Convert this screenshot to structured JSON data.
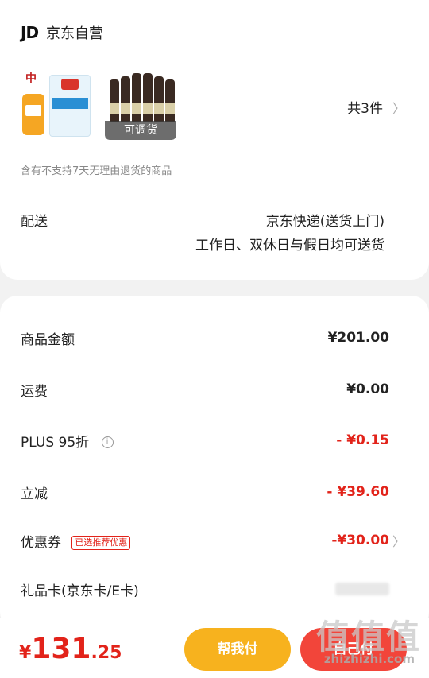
{
  "shop": {
    "logo": "JD",
    "name": "京东自营"
  },
  "products": {
    "beer_overlay": "可调货",
    "count_label": "共3件"
  },
  "notice": "含有不支持7天无理由退货的商品",
  "shipping": {
    "label": "配送",
    "method": "京东快递(送货上门)",
    "days": "工作日、双休日与假日均可送货"
  },
  "summary": {
    "rows": [
      {
        "label": "商品金额",
        "value": "¥201.00"
      },
      {
        "label": "运费",
        "value": "¥0.00"
      },
      {
        "label": "PLUS 95折",
        "value": "- ¥0.15"
      },
      {
        "label": "立减",
        "value": "- ¥39.60"
      },
      {
        "label": "优惠券",
        "badge": "已选推荐优惠",
        "value": "-¥30.00"
      },
      {
        "label": "礼品卡(京东卡/E卡)",
        "value": ""
      }
    ]
  },
  "footer": {
    "yen": "¥",
    "total_int": "131",
    "total_dec": ".25",
    "help_pay": "帮我付",
    "pay": "自己付"
  },
  "watermark": {
    "main": "值值值",
    "sub": "zhizhizhi.com"
  },
  "colors": {
    "accent_red": "#e2231a",
    "help_btn": "#f7b21e",
    "pay_btn": "#f2453a"
  }
}
